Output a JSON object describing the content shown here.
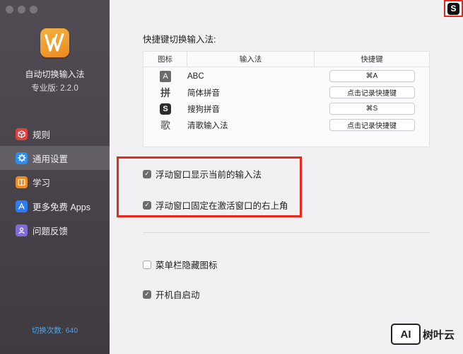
{
  "window": {
    "traffic_lights": [
      "close",
      "minimize",
      "zoom"
    ]
  },
  "sidebar": {
    "app_name": "自动切换输入法",
    "version": "专业版: 2.2.0",
    "items": [
      {
        "label": "规则",
        "icon": "rules-icon",
        "color": "#e2403c",
        "active": false
      },
      {
        "label": "通用设置",
        "icon": "gear-icon",
        "color": "#2b8ef0",
        "active": true
      },
      {
        "label": "学习",
        "icon": "learn-icon",
        "color": "#f08a1f",
        "active": false
      },
      {
        "label": "更多免费 Apps",
        "icon": "app-store-icon",
        "color": "#2f7bf5",
        "active": false
      },
      {
        "label": "问题反馈",
        "icon": "feedback-icon",
        "color": "#7f6ddb",
        "active": false
      }
    ],
    "switch_count": "切换次数: 640"
  },
  "main": {
    "section_title": "快捷键切换输入法:",
    "table": {
      "headers": {
        "icon": "图标",
        "method": "输入法",
        "shortcut": "快捷键"
      },
      "rows": [
        {
          "icon": "abc-input-icon",
          "glyph": "A",
          "method": "ABC",
          "shortcut": "⌘A"
        },
        {
          "icon": "pinyin-input-icon",
          "glyph": "拼",
          "method": "简体拼音",
          "shortcut": "点击记录快捷键"
        },
        {
          "icon": "sogou-input-icon",
          "glyph": "S",
          "method": "搜狗拼音",
          "shortcut": "⌘S"
        },
        {
          "icon": "qingge-input-icon",
          "glyph": "歌",
          "method": "清歌输入法",
          "shortcut": "点击记录快捷键"
        }
      ]
    },
    "options": [
      {
        "label": "浮动窗口显示当前的输入法",
        "checked": true
      },
      {
        "label": "浮动窗口固定在激活窗口的右上角",
        "checked": true
      },
      {
        "label": "菜单栏隐藏图标",
        "checked": false
      },
      {
        "label": "开机自启动",
        "checked": true
      }
    ]
  },
  "overlay": {
    "corner_badge_glyph": "S",
    "highlight_color": "#e8281e",
    "watermark_logo": "AI",
    "watermark_text": "树叶云"
  }
}
